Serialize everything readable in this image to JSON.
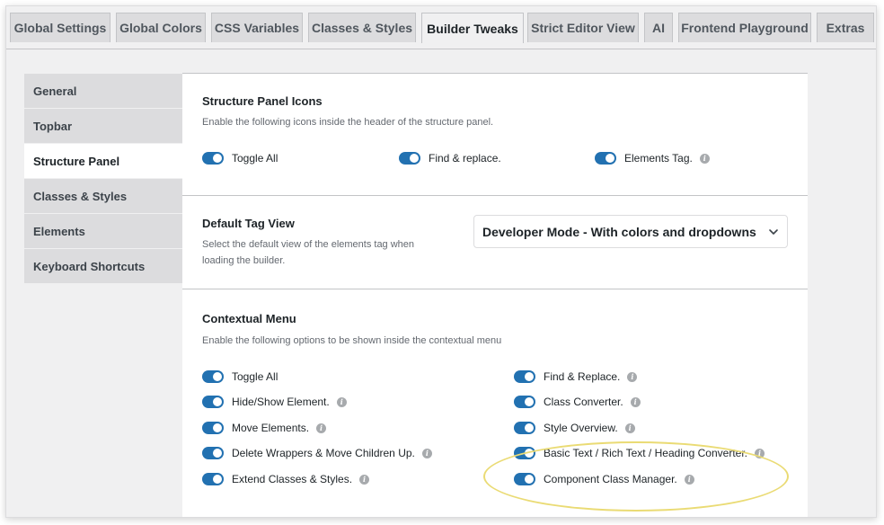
{
  "tabs": [
    {
      "label": "Global Settings"
    },
    {
      "label": "Global Colors"
    },
    {
      "label": "CSS Variables"
    },
    {
      "label": "Classes & Styles"
    },
    {
      "label": "Builder Tweaks",
      "active": true
    },
    {
      "label": "Strict Editor View"
    },
    {
      "label": "AI"
    },
    {
      "label": "Frontend Playground"
    },
    {
      "label": "Extras"
    }
  ],
  "sidebar": {
    "items": [
      {
        "label": "General"
      },
      {
        "label": "Topbar"
      },
      {
        "label": "Structure Panel",
        "active": true
      },
      {
        "label": "Classes & Styles"
      },
      {
        "label": "Elements"
      },
      {
        "label": "Keyboard Shortcuts"
      }
    ]
  },
  "structure_panel_icons": {
    "title": "Structure Panel Icons",
    "description": "Enable the following icons inside the header of the structure panel.",
    "options": [
      {
        "label": "Toggle All",
        "enabled": true,
        "info": false
      },
      {
        "label": "Find & replace.",
        "enabled": true,
        "info": false
      },
      {
        "label": "Elements Tag.",
        "enabled": true,
        "info": true
      }
    ]
  },
  "default_tag_view": {
    "title": "Default Tag View",
    "description_line1": "Select the default view of the elements tag when",
    "description_line2": "loading the builder.",
    "selected": "Developer Mode - With colors and dropdowns"
  },
  "contextual_menu": {
    "title": "Contextual Menu",
    "description": "Enable the following options to be shown inside the contextual menu",
    "left_options": [
      {
        "label": "Toggle All",
        "enabled": true,
        "info": false
      },
      {
        "label": "Hide/Show Element.",
        "enabled": true,
        "info": true
      },
      {
        "label": "Move Elements.",
        "enabled": true,
        "info": true
      },
      {
        "label": "Delete Wrappers & Move Children Up.",
        "enabled": true,
        "info": true
      },
      {
        "label": "Extend Classes & Styles.",
        "enabled": true,
        "info": true
      }
    ],
    "right_options": [
      {
        "label": "Find & Replace.",
        "enabled": true,
        "info": true
      },
      {
        "label": "Class Converter.",
        "enabled": true,
        "info": true
      },
      {
        "label": "Style Overview.",
        "enabled": true,
        "info": true
      },
      {
        "label": "Basic Text / Rich Text / Heading Converter.",
        "enabled": true,
        "info": true
      },
      {
        "label": "Component Class Manager.",
        "enabled": true,
        "info": true
      }
    ]
  },
  "icons": {
    "info": "info-icon",
    "chevron": "chevron-down-icon"
  },
  "colors": {
    "toggle_on": "#2271b1",
    "highlight": "#eadb74"
  }
}
